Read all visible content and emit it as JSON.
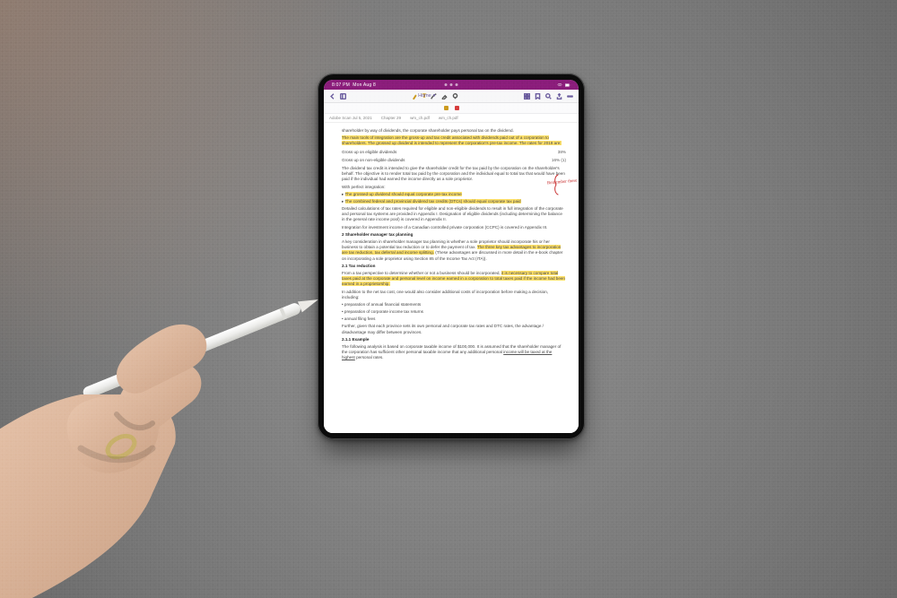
{
  "status": {
    "time": "8:07 PM",
    "date": "Mon Aug 8"
  },
  "toolbar": {
    "title": "Home",
    "chevron": "▾"
  },
  "toolrow": {
    "swatch1_color": "#cc9a1f",
    "swatch2_color": "#d63b3b"
  },
  "filebar": {
    "tab1": "Adobe Scan Jul 5, 2021",
    "tab2": "Chapter 29",
    "tab3": "wm_ch.pdf",
    "tab4": "wm_ch.pdf"
  },
  "doc": {
    "lead_in": "shareholder by way of dividends, the corporate shareholder pays personal tax on the dividend.",
    "hl1": "The main tools of integration are the gross-up and tax credit associated with dividends paid out of a corporation to shareholders. The grossed up dividend is intended to represent the corporation's pre-tax income. The rates for 2018 are:",
    "row1": {
      "l": "Gross up on eligible dividends",
      "r": "38%"
    },
    "row2": {
      "l": "Gross up on non-eligible dividends",
      "r": "16% (1)"
    },
    "p1": "The dividend tax credit is intended to give the shareholder credit for the tax paid by the corporation on the shareholder's behalf. The objective is to render total tax paid by the corporation and the individual equal to total tax that would have been paid if the individual had earned the income directly as a sole proprietor.",
    "p2": "With perfect integration:",
    "hl2a": "The grossed-up dividend should equal corporate pre-tax income",
    "hl2b": "The combined federal and provincial dividend tax credits (DTCs) should equal corporate tax paid",
    "p3": "Detailed calculations of tax rates required for eligible and non-eligible dividends to result in full integration of the corporate and personal tax systems are provided in Appendix I. Designation of eligible dividends (including determining the balance in the general rate income pool) is covered in Appendix II.",
    "p4": "Integration for investment income of a Canadian controlled private corporation (CCPC) is covered in Appendix III.",
    "s2": "2    Shareholder manager tax planning",
    "p5a": "A key consideration in shareholder manager tax planning is whether a sole proprietor should incorporate his or her business to obtain a potential tax reduction or to defer the payment of tax.",
    "hl3": "The three key tax advantages to incorporation are tax reduction, tax deferral and income splitting.",
    "p5b": "(These advantages are discussed in more detail in the e-book chapter on incorporating a sole proprietor using Section 85 of the Income Tax Act (ITA)).",
    "s21": "2.1    Tax reduction",
    "p6a": "From a tax perspective to determine whether or not a business should be incorporated,",
    "hl4": "it is necessary to compare total taxes paid at the corporate and personal level on income earned in a corporation to total taxes paid if the income had been earned in a proprietorship.",
    "p7": "In addition to the net tax cost, one would also consider additional costs of incorporation before making a decision, including:",
    "b1": "preparation of annual financial statements",
    "b2": "preparation of corporate income tax returns",
    "b3": "annual filing fees",
    "p8": "Further, given that each province sets its own personal and corporate tax rates and DTC rates, the advantage / disadvantage may differ between provinces.",
    "s211": "2.1.1  Example",
    "p9": "The following analysis is based on corporate taxable income of $100,000. It is assumed that the shareholder manager of the corporation has sufficient other personal taxable income that any additional personal",
    "p9u": "income will be taxed at the highest",
    "p9end": " personal rates.",
    "annotation": "Remember these"
  }
}
